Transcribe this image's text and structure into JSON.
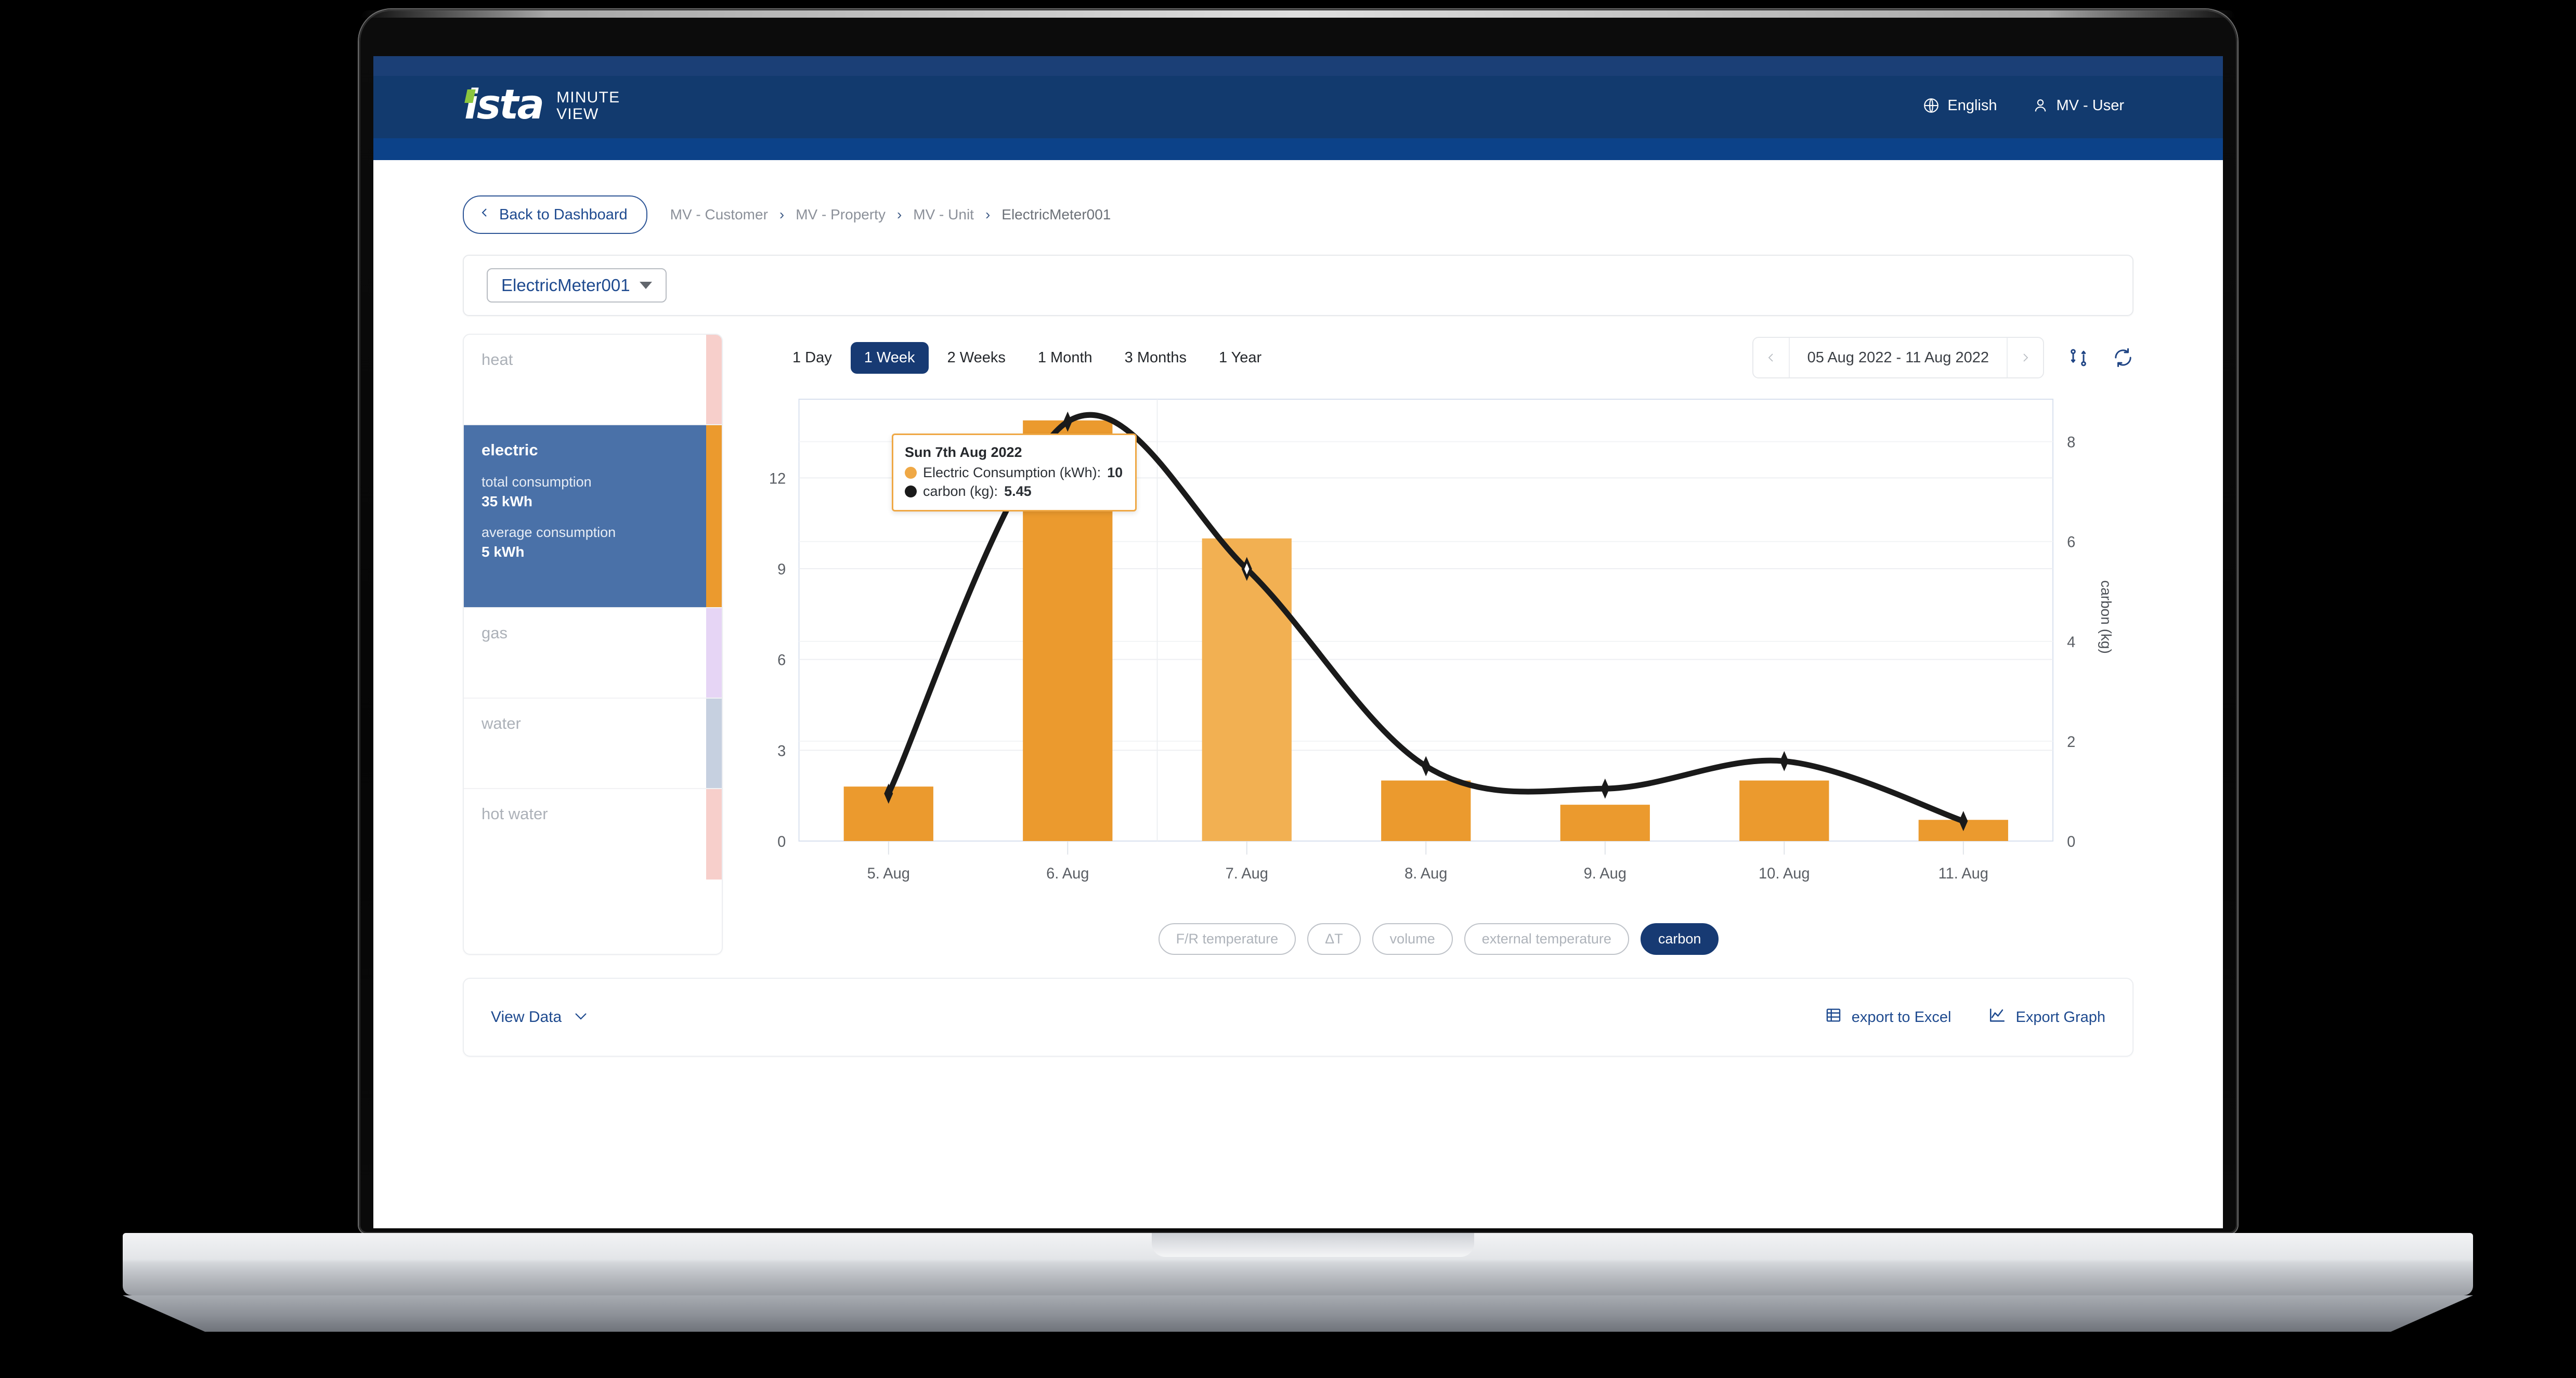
{
  "header": {
    "brand_name": "ista",
    "brand_line1": "MINUTE",
    "brand_line2": "VIEW",
    "language": "English",
    "user": "MV - User"
  },
  "nav": {
    "back_button": "Back to Dashboard",
    "breadcrumb": [
      "MV - Customer",
      "MV - Property",
      "MV - Unit",
      "ElectricMeter001"
    ]
  },
  "selector": {
    "meter": "ElectricMeter001"
  },
  "sidebar": {
    "items": [
      {
        "label": "heat",
        "accent": "#f7cfcb",
        "active": false
      },
      {
        "label": "electric",
        "accent": "#eb9a2e",
        "active": true,
        "total_label": "total consumption",
        "total_value": "35 kWh",
        "avg_label": "average consumption",
        "avg_value": "5 kWh"
      },
      {
        "label": "gas",
        "accent": "#e6d5f5",
        "active": false
      },
      {
        "label": "water",
        "accent": "#c6d0e0",
        "active": false
      },
      {
        "label": "hot water",
        "accent": "#f7cfcb",
        "active": false
      }
    ]
  },
  "toolbar": {
    "ranges": [
      "1 Day",
      "1 Week",
      "2 Weeks",
      "1 Month",
      "3 Months",
      "1 Year"
    ],
    "active_range": "1 Week",
    "date_range": "05 Aug 2022  -  11 Aug 2022",
    "compare_icon": "compare-icon",
    "refresh_icon": "refresh-icon"
  },
  "tooltip": {
    "title": "Sun 7th Aug 2022",
    "rows": [
      {
        "label": "Electric Consumption (kWh):",
        "value": "10",
        "color": "#efa845"
      },
      {
        "label": "carbon (kg):",
        "value": "5.45",
        "color": "#1a1a1a"
      }
    ]
  },
  "pills": {
    "items": [
      {
        "label": "F/R temperature",
        "active": false
      },
      {
        "label": "ΔT",
        "active": false
      },
      {
        "label": "volume",
        "active": false
      },
      {
        "label": "external temperature",
        "active": false
      },
      {
        "label": "carbon",
        "active": true
      }
    ]
  },
  "footer": {
    "view_data": "View Data",
    "export_excel": "export to Excel",
    "export_graph": "Export Graph"
  },
  "chart_data": {
    "type": "bar",
    "title": "",
    "categories": [
      "5. Aug",
      "6. Aug",
      "7. Aug",
      "8. Aug",
      "9. Aug",
      "10. Aug",
      "11. Aug"
    ],
    "series": [
      {
        "name": "Electric Consumption (kWh)",
        "type": "bar",
        "axis": "left",
        "color": "#eb9a2e",
        "highlight_color": "#f2b052",
        "highlight_index": 2,
        "values": [
          1.8,
          13.9,
          10.0,
          2.0,
          1.2,
          2.0,
          0.7
        ]
      },
      {
        "name": "carbon (kg)",
        "type": "line",
        "axis": "right",
        "color": "#1a1a1a",
        "values": [
          0.95,
          8.4,
          5.45,
          1.5,
          1.05,
          1.6,
          0.4
        ]
      }
    ],
    "ylabel": "Electric Consumption (kWh)",
    "y_ticks": [
      0,
      3,
      6,
      9,
      12
    ],
    "ylim": [
      0,
      14.6
    ],
    "y2label": "carbon (kg)",
    "y2_ticks": [
      0,
      2,
      4,
      6,
      8
    ],
    "y2lim": [
      0,
      8.85
    ],
    "xlabel": "",
    "grid": true,
    "legend": "none"
  }
}
